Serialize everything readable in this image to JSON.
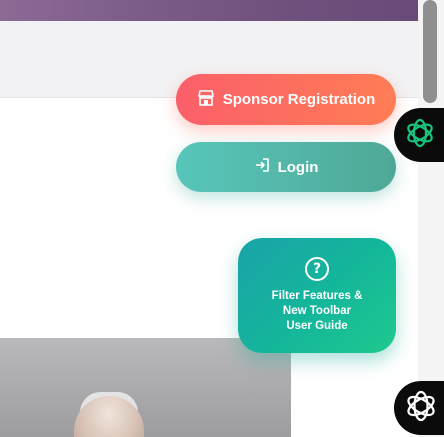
{
  "buttons": {
    "sponsor_label": "Sponsor Registration",
    "login_label": "Login"
  },
  "guide": {
    "icon_text": "?",
    "line1": "Filter Features &",
    "line2": "New Toolbar",
    "line3": "User Guide"
  },
  "icons": {
    "sponsor": "storefront-icon",
    "login": "login-arrow-icon",
    "guide": "question-circle-icon",
    "ai_top": "openai-logo-icon",
    "ai_bottom": "openai-logo-icon"
  },
  "colors": {
    "sponsor_gradient": [
      "#fb5f6a",
      "#ff7d55"
    ],
    "login_gradient": [
      "#58c6bb",
      "#4fa896"
    ],
    "guide_gradient": [
      "#1aa3a8",
      "#20c98e"
    ],
    "ai_accent": "#19c37d"
  }
}
